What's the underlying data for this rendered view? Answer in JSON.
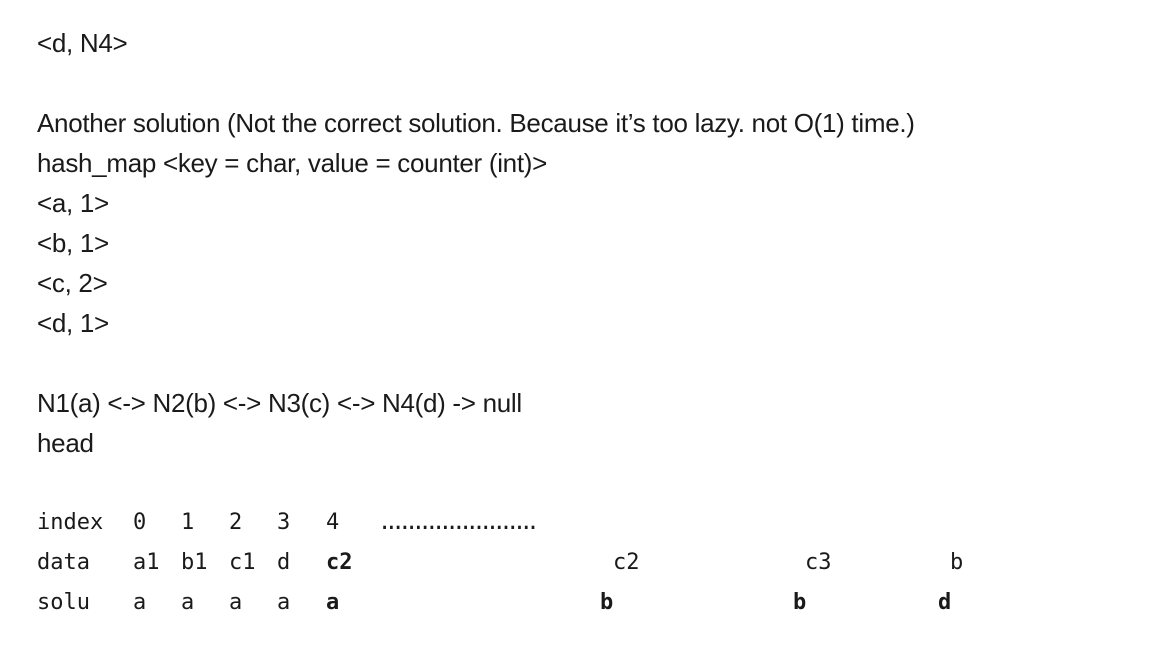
{
  "text_lines": {
    "line_d_n4": "<d, N4>",
    "another_solution": "Another solution (Not the correct solution. Because it’s too lazy. not O(1) time.)",
    "hash_map": "hash_map <key = char, value = counter (int)>",
    "entry_a": "<a, 1>",
    "entry_b": "<b, 1>",
    "entry_c": "<c, 2>",
    "entry_d": "<d, 1>",
    "linked_list": "N1(a) <-> N2(b) <-> N3(c) <-> N4(d) -> null",
    "head": "head"
  },
  "table": {
    "index_label": "index",
    "index_values": [
      "0",
      "1",
      "2",
      "3",
      "4"
    ],
    "index_dots": ".......................",
    "data_label": "data",
    "data_values": [
      "a1",
      "b1",
      "c1",
      "d",
      "c2",
      "c2",
      "c3",
      "b"
    ],
    "solu_label": "solu",
    "solu_values": [
      "a",
      "a",
      "a",
      "a",
      "a",
      "b",
      "b",
      "d"
    ]
  }
}
